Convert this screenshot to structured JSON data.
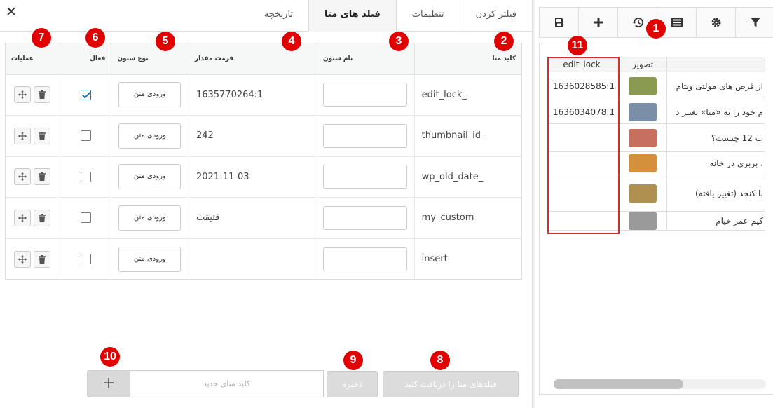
{
  "modal": {
    "close_label": "✕",
    "tabs": [
      {
        "label": "فیلتر کردن",
        "active": false
      },
      {
        "label": "تنظیمات",
        "active": false
      },
      {
        "label": "فیلد های متا",
        "active": true
      },
      {
        "label": "تاریخچه",
        "active": false
      }
    ],
    "table": {
      "headers": {
        "meta_key": "کلید متا",
        "column_name": "نام ستون",
        "value_format": "فرمت مقدار",
        "column_type": "نوع ستون",
        "active": "فعال",
        "operations": "عملیات"
      },
      "rows": [
        {
          "key": "edit_lock_",
          "format": "1635770264:1",
          "type_label": "ورودی متن",
          "checked": true
        },
        {
          "key": "thumbnail_id_",
          "format": "242",
          "type_label": "ورودی متن",
          "checked": false
        },
        {
          "key": "wp_old_date_",
          "format": "2021-11-03",
          "type_label": "ورودی متن",
          "checked": false
        },
        {
          "key": "my_custom",
          "format": "قثیقث",
          "type_label": "ورودی متن",
          "checked": false
        },
        {
          "key": "insert",
          "format": "",
          "type_label": "ورودی متن",
          "checked": false
        }
      ]
    },
    "bottom": {
      "add_label": "+",
      "new_key_placeholder": "کلید متای جدید",
      "save_label": "ذخیره",
      "fetch_label": "فیلدهای متا را دریافت کنید"
    },
    "markers": [
      "1",
      "2",
      "3",
      "4",
      "5",
      "6",
      "7",
      "8",
      "9",
      "10",
      "11"
    ]
  },
  "side": {
    "toolbar_icons": [
      "save-icon",
      "plus-icon",
      "history-icon",
      "columns-icon",
      "gear-icon",
      "filter-icon"
    ],
    "grid": {
      "headers": {
        "edit_lock": "edit_lock_",
        "image": "تصویر",
        "title": ""
      },
      "rows": [
        {
          "edit_lock": "1636028585:1",
          "title": "از قرص های مولتی ویتام",
          "thumb_color": "#8a9a50"
        },
        {
          "edit_lock": "1636034078:1",
          "title": "م خود را به «متا» تغییر د",
          "thumb_color": "#7a8ea8"
        },
        {
          "edit_lock": "",
          "title": "ب 12 چیست؟",
          "thumb_color": "#c87060"
        },
        {
          "edit_lock": "",
          "title": "، بربری در خانه",
          "thumb_color": "#d4903a"
        },
        {
          "edit_lock": "",
          "title": "با کنجد (تغییر یافته)",
          "thumb_color": "#b09050"
        },
        {
          "edit_lock": "",
          "title": "کیم عمر خیام",
          "thumb_color": "#9a9a9a"
        }
      ]
    },
    "colors": {
      "marker": "#e00000",
      "highlight_border": "#d32f2f",
      "check": "#2271b1"
    }
  }
}
